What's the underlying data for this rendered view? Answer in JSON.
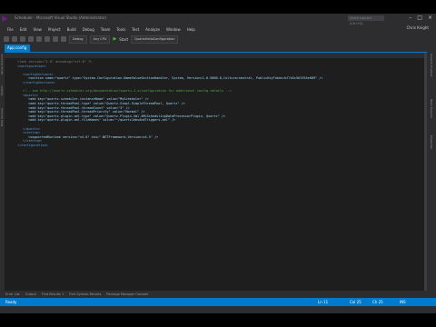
{
  "window": {
    "title": "Scheduler - Microsoft Visual Studio (Administrator)",
    "quick_launch_placeholder": "Quick Launch (Ctrl+Q)",
    "user": "Chris Knight"
  },
  "menu": [
    "File",
    "Edit",
    "View",
    "Project",
    "Build",
    "Debug",
    "Team",
    "Tools",
    "Test",
    "Analyze",
    "Window",
    "Help"
  ],
  "toolbar": {
    "config": "Debug",
    "platform": "Any CPU",
    "start_label": "Start",
    "start_config": "QuartzHelloConfiguration"
  },
  "document_tab": "App.config",
  "left_tabs": [
    "Server Explorer",
    "Toolbox",
    "Data Sources"
  ],
  "right_tabs": [
    "Solution Explorer",
    "Team Explorer",
    "Properties"
  ],
  "code": [
    {
      "ind": 0,
      "c": "#808080",
      "t": "<?xml version=\"1.0\" encoding=\"utf-8\" ?>"
    },
    {
      "ind": 0,
      "c": "#569cd6",
      "t": "<configuration>"
    },
    {
      "ind": 0,
      "c": "#569cd6",
      "t": ""
    },
    {
      "ind": 1,
      "c": "#569cd6",
      "t": "<configSections>"
    },
    {
      "ind": 2,
      "c": "#9cdcfe",
      "t": "<section name=\"quartz\" type=\"System.Configuration.NameValueSectionHandler, System, Version=1.0.5000.0,Culture=neutral, PublicKeyToken=b77a5c561934e089\" />"
    },
    {
      "ind": 1,
      "c": "#569cd6",
      "t": "</configSections>"
    },
    {
      "ind": 0,
      "c": "#569cd6",
      "t": ""
    },
    {
      "ind": 1,
      "c": "#57a64a",
      "t": "<!-- see http://quartz-scheduler.org/documentation/quartz-2.x/configuration for additional config details -->"
    },
    {
      "ind": 1,
      "c": "#569cd6",
      "t": "<quartz>"
    },
    {
      "ind": 2,
      "c": "#9cdcfe",
      "t": "<add key=\"quartz.scheduler.instanceName\" value=\"MyScheduler\" />"
    },
    {
      "ind": 2,
      "c": "#9cdcfe",
      "t": "<add key=\"quartz.threadPool.type\" value=\"Quartz.Simpl.SimpleThreadPool, Quartz\" />"
    },
    {
      "ind": 2,
      "c": "#9cdcfe",
      "t": "<add key=\"quartz.threadPool.threadCount\" value=\"3\" />"
    },
    {
      "ind": 2,
      "c": "#9cdcfe",
      "t": "<add key=\"quartz.threadPool.threadPriority\" value=\"Normal\" />"
    },
    {
      "ind": 2,
      "c": "#9cdcfe",
      "t": "<add key=\"quartz.plugin.xml.type\" value=\"Quartz.Plugin.Xml.XMLSchedulingDataProcessorPlugin, Quartz\" />"
    },
    {
      "ind": 2,
      "c": "#9cdcfe",
      "t": "<add key=\"quartz.plugin.xml.fileNames\" value=\"~/quartzJobsAndTriggers.xml\" />"
    },
    {
      "ind": 1,
      "c": "#569cd6",
      "t": ""
    },
    {
      "ind": 1,
      "c": "#569cd6",
      "t": "</quartz>"
    },
    {
      "ind": 1,
      "c": "#569cd6",
      "t": "<startup>"
    },
    {
      "ind": 2,
      "c": "#9cdcfe",
      "t": "<supportedRuntime version=\"v4.0\" sku=\".NETFramework,Version=v4.5\" />"
    },
    {
      "ind": 1,
      "c": "#569cd6",
      "t": "</startup>"
    },
    {
      "ind": 0,
      "c": "#569cd6",
      "t": "</configuration>"
    }
  ],
  "bottom_tabs": [
    "Error List",
    "Output",
    "Find Results 1",
    "Find Symbol Results",
    "Package Manager Console"
  ],
  "status": {
    "ready": "Ready",
    "line": "Ln 11",
    "col": "Col 25",
    "ch": "Ch 25",
    "mode": "INS"
  }
}
